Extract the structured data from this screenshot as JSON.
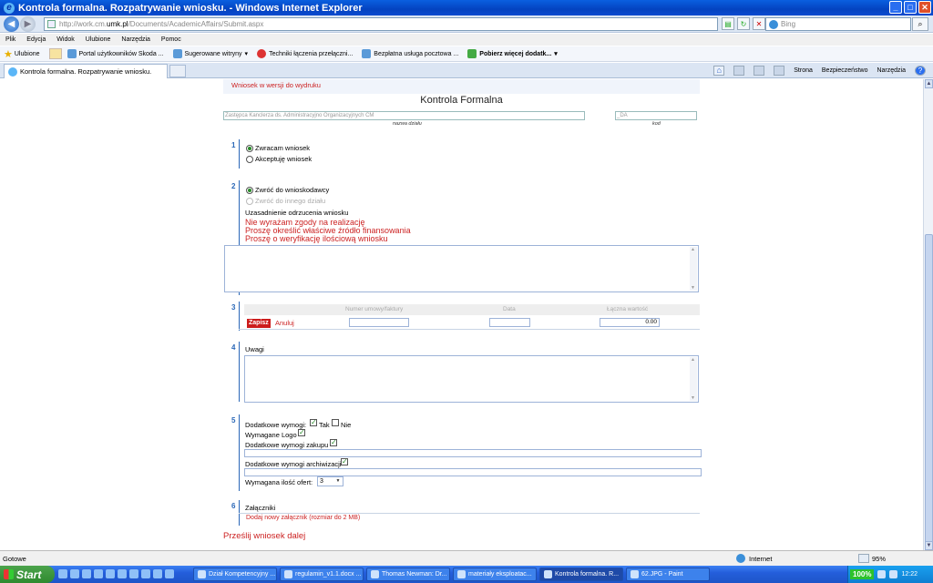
{
  "window": {
    "title": "Kontrola formalna. Rozpatrywanie wniosku. - Windows Internet Explorer"
  },
  "address": {
    "prefix": "http://work.cm.",
    "domain": "umk.pl",
    "path": "/Documents/AcademicAffairs/Submit.aspx",
    "search_placeholder": "Bing"
  },
  "menu": [
    "Plik",
    "Edycja",
    "Widok",
    "Ulubione",
    "Narzędzia",
    "Pomoc"
  ],
  "favorites": {
    "label": "Ulubione",
    "items": [
      "Portal użytkowników Skoda ...",
      "Sugerowane witryny",
      "Techniki łączenia przełączni...",
      "Bezpłatna usługa pocztowa ...",
      "Pobierz więcej dodatk..."
    ]
  },
  "tab": {
    "label": "Kontrola formalna. Rozpatrywanie wniosku."
  },
  "commands": [
    "Strona",
    "Bezpieczeństwo",
    "Narzędzia"
  ],
  "form": {
    "top_link": "Wniosek w wersji do wydruku",
    "title": "Kontrola Formalna",
    "department_value": "Zastępca Kanclerza ds. Administracyjno Organizacyjnych CM",
    "department_caption": "nazwa działu",
    "code_value": "_DA",
    "code_caption": "kod",
    "sections": [
      "1",
      "2",
      "3",
      "4",
      "5",
      "6"
    ],
    "s1": {
      "option1": "Zwracam wniosek",
      "option2": "Akceptuję wniosek"
    },
    "s2": {
      "option1": "Zwróć do wnioskodawcy",
      "option2": "Zwróć do innego działu",
      "reason_label": "Uzasadnienie odrzucenia wniosku",
      "reasons": [
        "Nie wyrażam zgody na realizację",
        "Proszę określić właściwe źródło finansowania",
        "Proszę o weryfikację ilościową wniosku"
      ]
    },
    "s3": {
      "col1": "Numer umowy/faktury",
      "col2": "Data",
      "col3": "Łączna wartość",
      "save": "Zapisz",
      "cancel": "Anuluj",
      "total_value": "0.00"
    },
    "s4": {
      "label": "Uwagi"
    },
    "s5": {
      "extra_req": "Dodatkowe wymogi:",
      "yes": "Tak",
      "no": "Nie",
      "logo": "Wymagane Logo",
      "purchase": "Dodatkowe wymogi zakupu",
      "archive": "Dodatkowe wymogi archiwizacji",
      "offers": "Wymagana ilość ofert:",
      "offers_value": "3"
    },
    "s6": {
      "label": "Załączniki",
      "add_link": "Dodaj nowy załącznik (rozmiar do 2 MB)"
    },
    "submit": "Prześlij wniosek dalej"
  },
  "status": {
    "text": "Gotowe",
    "zone": "Internet",
    "zoom": "95%"
  },
  "taskbar": {
    "start": "Start",
    "tasks": [
      "Dział Kompetencyjny ...",
      "regulamin_v1.1.docx ...",
      "Thomas Newman: Dr...",
      "materiały eksploatac...",
      "Kontrola formalna. R...",
      "62.JPG - Paint"
    ],
    "zoom_badge": "100%",
    "clock": "12:22"
  }
}
